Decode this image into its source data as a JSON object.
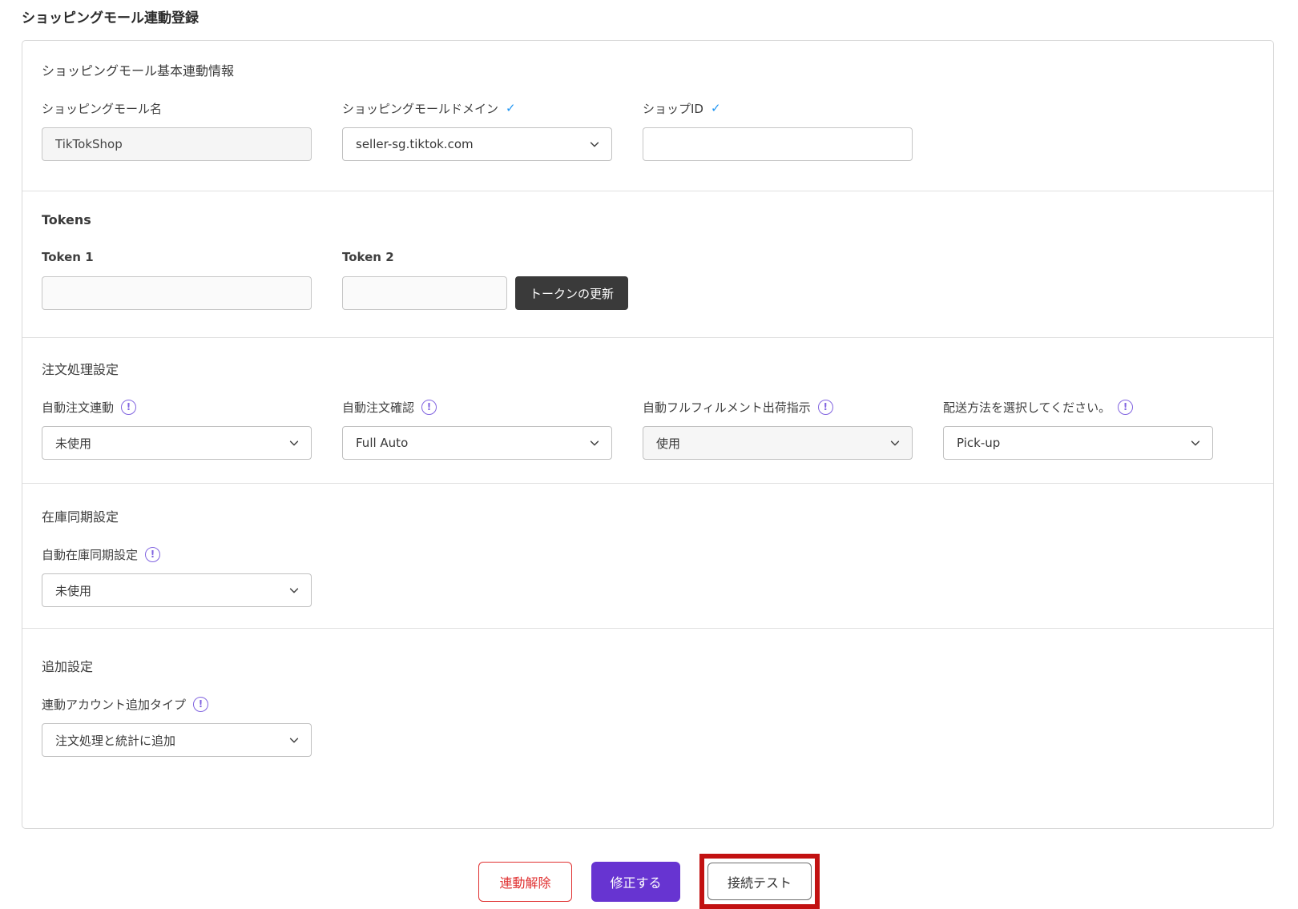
{
  "page": {
    "title": "ショッピングモール連動登録"
  },
  "ui": {
    "required_check": "✓",
    "info_mark": "!"
  },
  "basic_info": {
    "heading": "ショッピングモール基本連動情報",
    "fields": {
      "mall_name": {
        "label": "ショッピングモール名",
        "value": "TikTokShop"
      },
      "mall_domain": {
        "label": "ショッピングモールドメイン",
        "value": "seller-sg.tiktok.com"
      },
      "shop_id": {
        "label": "ショップID",
        "value": ""
      }
    }
  },
  "tokens": {
    "heading": "Tokens",
    "token1_label": "Token 1",
    "token1_value": "",
    "token2_label": "Token 2",
    "token2_value": "",
    "refresh_button": "トークンの更新"
  },
  "order_settings": {
    "heading": "注文処理設定",
    "fields": [
      {
        "label": "自動注文連動",
        "value": "未使用"
      },
      {
        "label": "自動注文確認",
        "value": "Full Auto"
      },
      {
        "label": "自動フルフィルメント出荷指示",
        "value": "使用"
      },
      {
        "label": "配送方法を選択してください。",
        "value": "Pick-up"
      }
    ]
  },
  "inventory_settings": {
    "heading": "在庫同期設定",
    "field": {
      "label": "自動在庫同期設定",
      "value": "未使用"
    }
  },
  "additional_settings": {
    "heading": "追加設定",
    "field": {
      "label": "連動アカウント追加タイプ",
      "value": "注文処理と統計に追加"
    }
  },
  "actions": {
    "unlink": "連動解除",
    "modify": "修正する",
    "test": "接続テスト"
  },
  "colors": {
    "primary_purple": "#6734d1",
    "info_icon_purple": "#8164e0",
    "required_check_blue": "#2196f3",
    "danger_red": "#e03131",
    "highlight_red": "#c21111",
    "dark_button": "#3a3a3a"
  }
}
